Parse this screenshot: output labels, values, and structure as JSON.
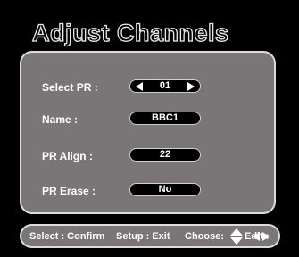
{
  "title": "Adjust Channels",
  "rows": [
    {
      "label": "Select PR :",
      "value": "01",
      "has_arrows": true
    },
    {
      "label": "Name :",
      "value": "BBC1",
      "has_arrows": false
    },
    {
      "label": "PR Align :",
      "value": "22",
      "has_arrows": false
    },
    {
      "label": "PR Erase :",
      "value": "No",
      "has_arrows": false
    }
  ],
  "help": {
    "select_confirm": "Select : Confirm",
    "setup_exit": "Setup : Exit",
    "choose": "Choose:",
    "edit": "Edit :"
  },
  "icons": {
    "row0_left": "arrow-left-icon",
    "row0_right": "arrow-right-icon",
    "choose": "up-down-arrow-icon",
    "edit": "left-right-arrow-icon"
  },
  "colors": {
    "background": "#000000",
    "panel": "#7a7677",
    "border": "#dcdcdc",
    "text": "#ffffff"
  }
}
